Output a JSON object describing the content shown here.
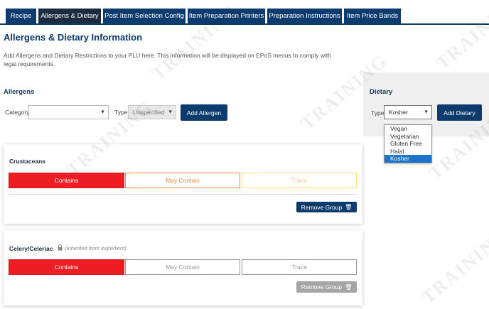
{
  "tabs": [
    {
      "label": "Recipe"
    },
    {
      "label": "Allergens & Dietary"
    },
    {
      "label": "Post Item Selection Config"
    },
    {
      "label": "Item Preparation Printers"
    },
    {
      "label": "Preparation Instructions"
    },
    {
      "label": "Item Price Bands"
    }
  ],
  "page": {
    "title": "Allergens & Dietary Information",
    "description": "Add Allergens and Dietary Restrictions to your PLU here. This information will be displayed on EPoS menus to comply with legal requirements."
  },
  "allergens": {
    "heading": "Allergens",
    "category_label": "Category",
    "category_value": "",
    "type_label": "Type",
    "type_value": "Unspecified",
    "add_button": "Add Allergen"
  },
  "dietary": {
    "heading": "Dietary",
    "type_label": "Type",
    "type_value": "Kosher",
    "add_button": "Add Dietary",
    "options": [
      "Vegan",
      "Vegetarian",
      "Gluten Free",
      "Halal",
      "Kosher"
    ],
    "selected_option": "Kosher"
  },
  "groups": [
    {
      "name": "Crustaceans",
      "inherited_note": "",
      "contains": "Contains",
      "may_contain": "May Contain",
      "trace": "Trace",
      "remove_button": "Remove Group"
    },
    {
      "name": "Celery/Celeriac",
      "inherited_note": "(Inherited from Ingredient)",
      "contains": "Contains",
      "may_contain": "May Contain",
      "trace": "Trace",
      "remove_button": "Remove Group"
    }
  ],
  "watermark": "TRAINING",
  "colors": {
    "navy": "#0d3b6e",
    "contains_red": "#ee1d23",
    "may_contain_orange": "#f08a3e",
    "trace_yellow": "#f8df7c",
    "selected_blue": "#1e72c9"
  }
}
